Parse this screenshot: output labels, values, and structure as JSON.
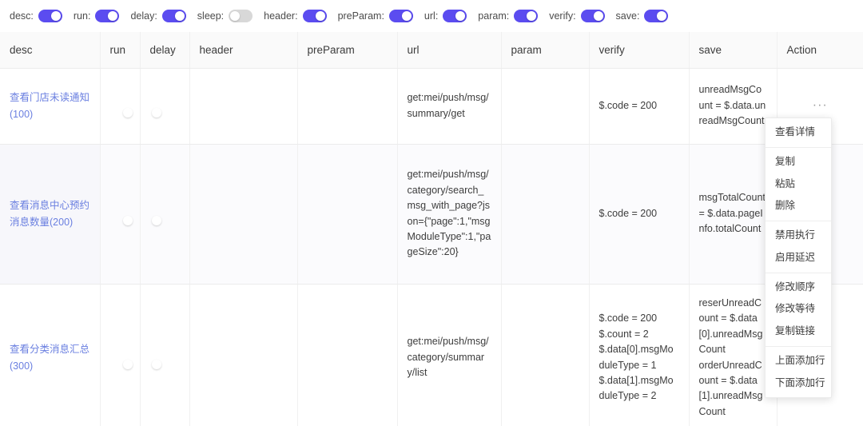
{
  "toolbar": {
    "toggles": [
      {
        "label": "desc:",
        "name": "toggle-desc",
        "on": true
      },
      {
        "label": "run:",
        "name": "toggle-run",
        "on": true
      },
      {
        "label": "delay:",
        "name": "toggle-delay",
        "on": true
      },
      {
        "label": "sleep:",
        "name": "toggle-sleep",
        "on": false
      },
      {
        "label": "header:",
        "name": "toggle-header",
        "on": true
      },
      {
        "label": "preParam:",
        "name": "toggle-preparam",
        "on": true
      },
      {
        "label": "url:",
        "name": "toggle-url",
        "on": true
      },
      {
        "label": "param:",
        "name": "toggle-param",
        "on": true
      },
      {
        "label": "verify:",
        "name": "toggle-verify",
        "on": true
      },
      {
        "label": "save:",
        "name": "toggle-save",
        "on": true
      }
    ]
  },
  "table": {
    "columns": [
      {
        "key": "desc",
        "label": "desc"
      },
      {
        "key": "run",
        "label": "run"
      },
      {
        "key": "delay",
        "label": "delay"
      },
      {
        "key": "header",
        "label": "header"
      },
      {
        "key": "preParam",
        "label": "preParam"
      },
      {
        "key": "url",
        "label": "url"
      },
      {
        "key": "param",
        "label": "param"
      },
      {
        "key": "verify",
        "label": "verify"
      },
      {
        "key": "save",
        "label": "save"
      },
      {
        "key": "action",
        "label": "Action"
      }
    ],
    "rows": [
      {
        "desc": "查看门店未读通知(100)",
        "run": true,
        "delay": false,
        "header": "",
        "preParam": "",
        "url": "get:mei/push/msg/summary/get",
        "param": "",
        "verify": "$.code = 200",
        "save": "unreadMsgCount = $.data.unreadMsgCount",
        "action": "···"
      },
      {
        "desc": "查看消息中心预约消息数量(200)",
        "run": true,
        "delay": false,
        "header": "",
        "preParam": "",
        "url": "get:mei/push/msg/category/search_msg_with_page?json={\"page\":1,\"msgModuleType\":1,\"pageSize\":20}",
        "param": "",
        "verify": "$.code = 200",
        "save": "msgTotalCount = $.data.pageInfo.totalCount",
        "action": "···"
      },
      {
        "desc": "查看分类消息汇总(300)",
        "run": true,
        "delay": false,
        "header": "",
        "preParam": "",
        "url": "get:mei/push/msg/category/summary/list",
        "param": "",
        "verify": "$.code = 200\n$.count = 2\n$.data[0].msgModuleType = 1\n$.data[1].msgModuleType = 2",
        "save": "reserUnreadCount = $.data[0].unreadMsgCount\norderUnreadCount = $.data[1].unreadMsgCount",
        "action": "···"
      }
    ]
  },
  "context_menu": {
    "groups": [
      [
        "查看详情"
      ],
      [
        "复制",
        "粘贴",
        "删除"
      ],
      [
        "禁用执行",
        "启用延迟"
      ],
      [
        "修改顺序",
        "修改等待",
        "复制链接"
      ],
      [
        "上面添加行",
        "下面添加行"
      ]
    ]
  },
  "colors": {
    "accent": "#5b4cf0",
    "link": "#6a7fe0",
    "switch_off": "#d8d8d8",
    "header_bg": "#fafafa",
    "border": "#ececec"
  }
}
